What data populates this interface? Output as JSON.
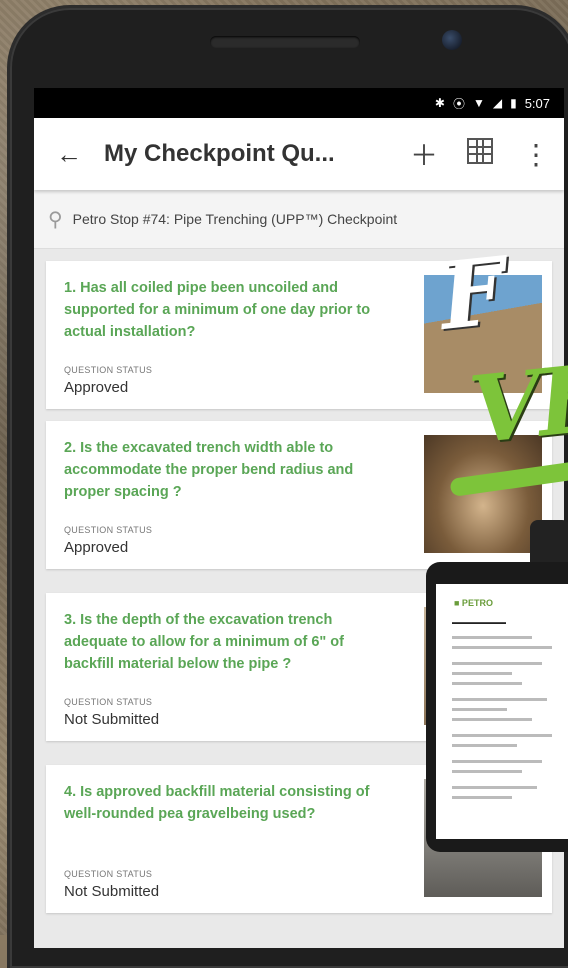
{
  "statusbar": {
    "time": "5:07",
    "icons": [
      "bluetooth-icon",
      "vibrate-icon",
      "wifi-icon",
      "signal-icon",
      "battery-icon"
    ]
  },
  "appbar": {
    "title": "My Checkpoint Qu...",
    "back_icon": "back-arrow-icon",
    "add_icon": "plus-icon",
    "grid_icon": "grid-icon",
    "more_icon": "more-vert-icon"
  },
  "search": {
    "value": "Petro Stop #74: Pipe Trenching (UPP™) Checkpoint"
  },
  "questions": [
    {
      "text": "1. Has all coiled pipe been uncoiled and supported for a minimum of one day prior to actual installation?",
      "status_label": "QUESTION STATUS",
      "status": "Approved"
    },
    {
      "text": "2. Is the excavated trench width able to accommodate the proper bend radius and proper spacing ?",
      "status_label": "QUESTION STATUS",
      "status": "Approved"
    },
    {
      "text": "3. Is the depth of the excavation trench adequate to allow for a minimum of 6\" of backfill material below the pipe ?",
      "status_label": "QUESTION STATUS",
      "status": "Not Submitted"
    },
    {
      "text": "4. Is approved backfill material consisting of well-rounded pea gravelbeing used?",
      "status_label": "QUESTION STATUS",
      "status": "Not Submitted"
    }
  ],
  "overlay": {
    "brush_word_1": "F",
    "brush_word_2": "VE"
  },
  "colors": {
    "accent_green": "#5aa656",
    "brush_green": "#7dc43a"
  }
}
